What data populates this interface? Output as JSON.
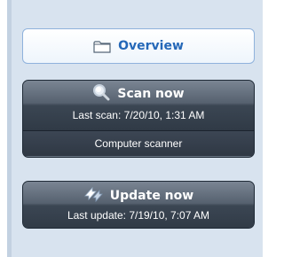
{
  "nav": {
    "overview_label": "Overview"
  },
  "scan": {
    "title": "Scan now",
    "subtitle": "Last scan: 7/20/10, 1:31 AM",
    "secondary": "Computer scanner"
  },
  "update": {
    "title": "Update now",
    "subtitle": "Last update: 7/19/10, 7:07 AM"
  },
  "icons": {
    "overview": "folder-icon",
    "scan": "magnifier-icon",
    "update": "update-arrows-icon"
  },
  "colors": {
    "sidebar_bg": "#d8e3ef",
    "nav_text": "#2568b8",
    "card_dark": "#37414d"
  }
}
